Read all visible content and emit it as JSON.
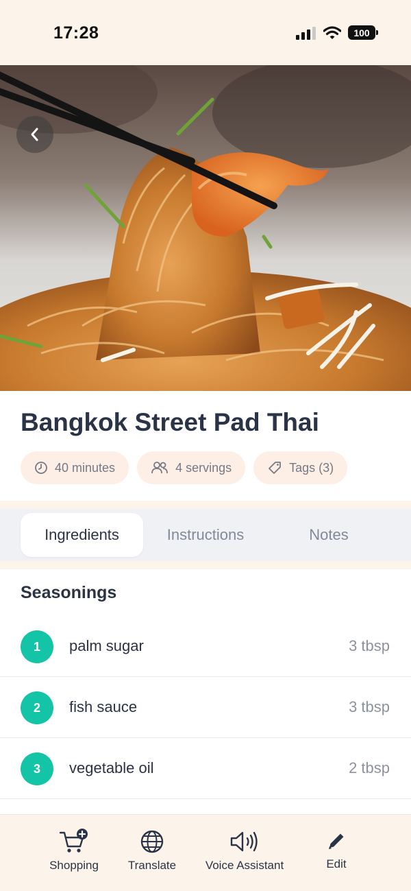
{
  "status_bar": {
    "time": "17:28",
    "battery": "100"
  },
  "recipe": {
    "title": "Bangkok Street Pad Thai",
    "chips": {
      "time": "40 minutes",
      "servings": "4 servings",
      "tags": "Tags (3)"
    }
  },
  "tabs": [
    {
      "label": "Ingredients",
      "active": true
    },
    {
      "label": "Instructions",
      "active": false
    },
    {
      "label": "Notes",
      "active": false
    }
  ],
  "ingredients": {
    "section_title": "Seasonings",
    "items": [
      {
        "number": "1",
        "name": "palm sugar",
        "quantity": "3 tbsp"
      },
      {
        "number": "2",
        "name": "fish sauce",
        "quantity": "3 tbsp"
      },
      {
        "number": "3",
        "name": "vegetable oil",
        "quantity": "2 tbsp"
      }
    ]
  },
  "bottom_nav": [
    {
      "label": "Shopping",
      "icon": "cart-plus-icon"
    },
    {
      "label": "Translate",
      "icon": "globe-icon"
    },
    {
      "label": "Voice Assistant",
      "icon": "speaker-icon"
    },
    {
      "label": "Edit",
      "icon": "pencil-icon"
    }
  ],
  "colors": {
    "accent": "#14c4a6",
    "chip_bg": "#fdeee6",
    "band_bg": "#fcf3eb",
    "title": "#2b3446"
  }
}
